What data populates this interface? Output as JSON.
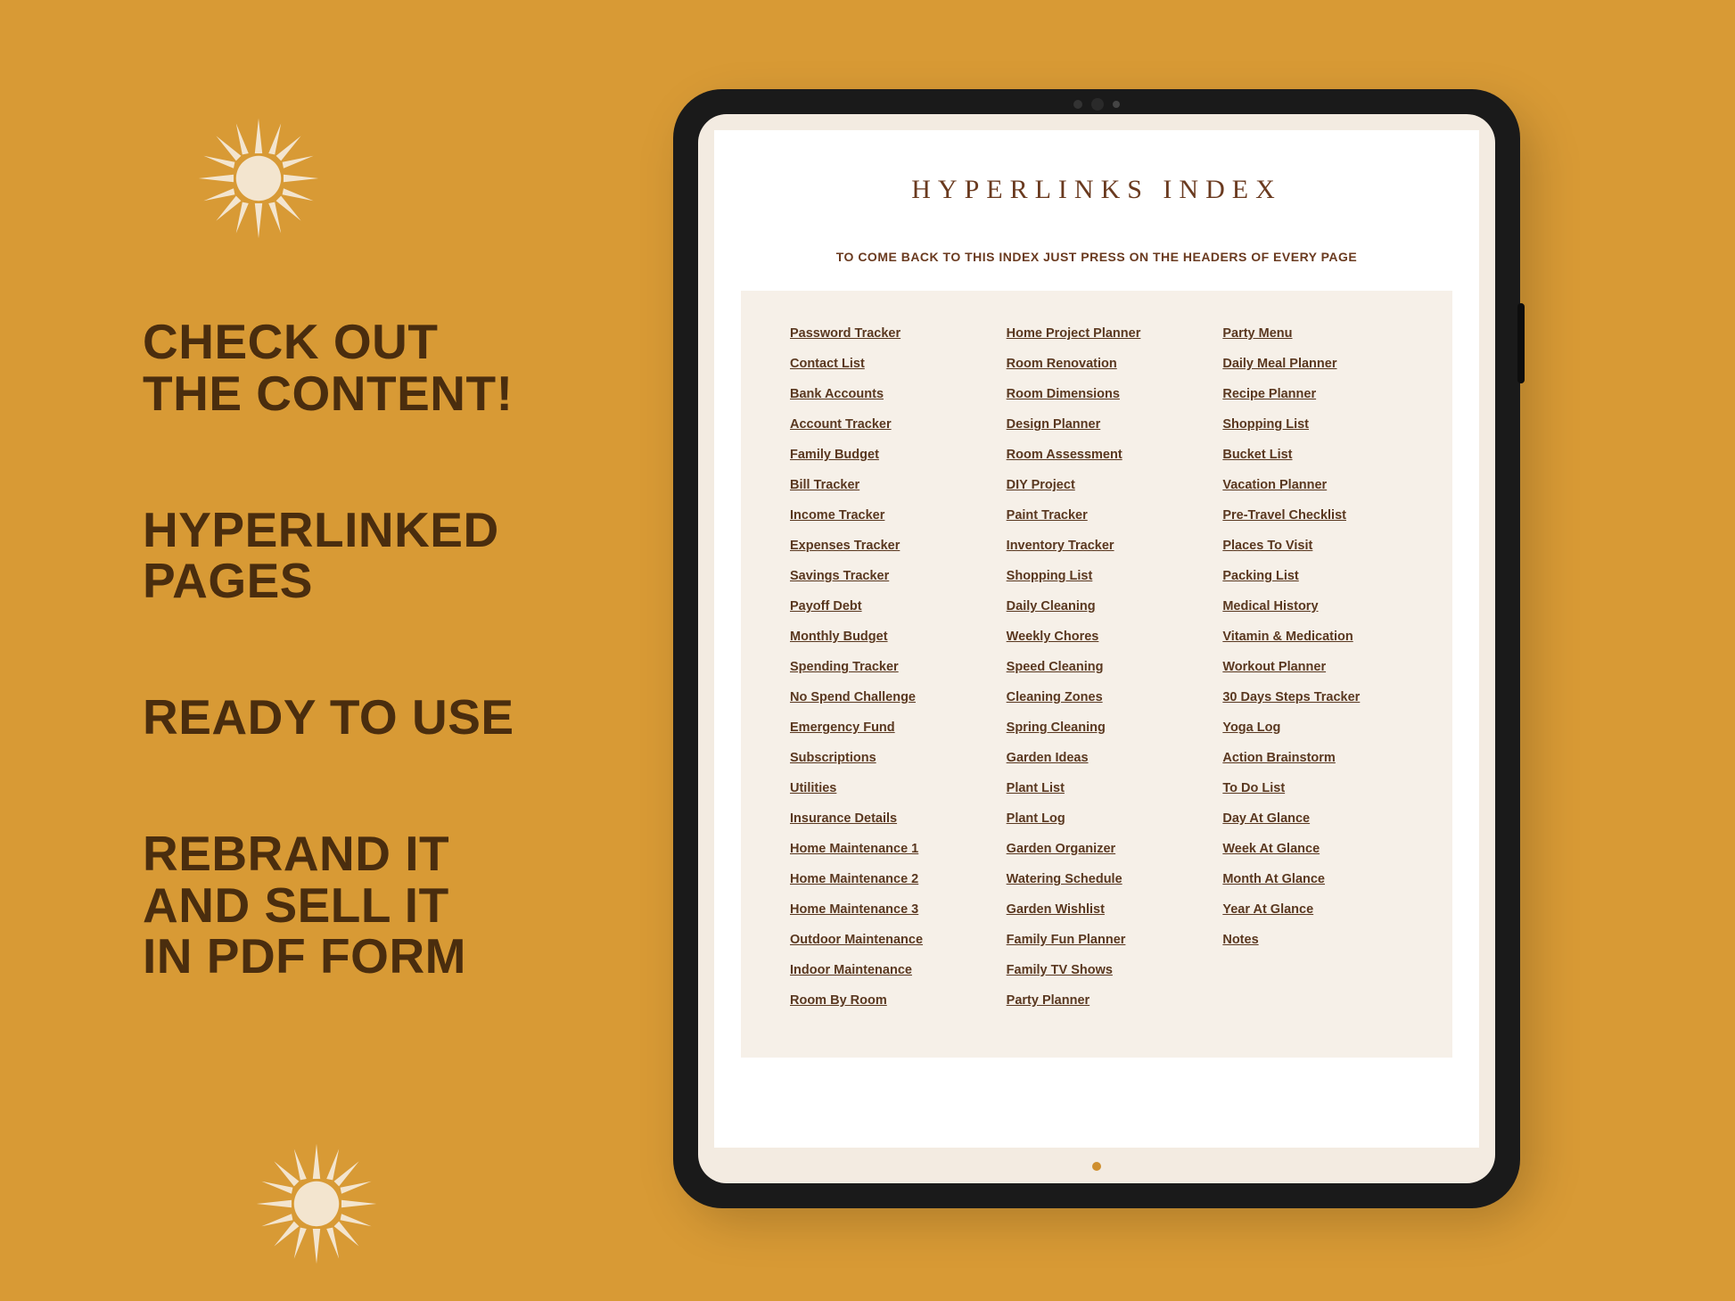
{
  "promo": {
    "line1a": "CHECK OUT",
    "line1b": "THE CONTENT!",
    "line2a": "HYPERLINKED",
    "line2b": "PAGES",
    "line3": "READY TO USE",
    "line4a": "REBRAND IT",
    "line4b": "AND SELL IT",
    "line4c": "IN PDF FORM"
  },
  "page": {
    "title": "HYPERLINKS INDEX",
    "subtitle": "TO COME BACK TO THIS INDEX JUST PRESS ON THE HEADERS OF EVERY PAGE"
  },
  "columns": [
    [
      "Password Tracker",
      "Contact List",
      "Bank Accounts",
      "Account Tracker",
      "Family Budget",
      "Bill Tracker",
      "Income Tracker",
      "Expenses Tracker",
      "Savings Tracker",
      "Payoff Debt",
      "Monthly Budget",
      "Spending Tracker",
      "No Spend Challenge",
      "Emergency Fund",
      "Subscriptions",
      "Utilities",
      "Insurance Details",
      "Home Maintenance 1",
      "Home Maintenance 2",
      "Home Maintenance 3",
      "Outdoor Maintenance",
      "Indoor Maintenance",
      "Room By Room"
    ],
    [
      "Home Project Planner",
      "Room Renovation",
      "Room Dimensions",
      "Design Planner",
      "Room Assessment",
      "DIY Project",
      "Paint Tracker",
      "Inventory Tracker",
      "Shopping List",
      "Daily Cleaning",
      "Weekly Chores",
      "Speed Cleaning",
      "Cleaning Zones",
      "Spring Cleaning",
      "Garden Ideas",
      "Plant List",
      "Plant Log",
      "Garden Organizer",
      "Watering Schedule",
      "Garden Wishlist",
      "Family Fun Planner",
      "Family TV Shows",
      "Party Planner"
    ],
    [
      "Party Menu",
      "Daily Meal Planner",
      "Recipe Planner",
      "Shopping List",
      "Bucket List",
      "Vacation Planner",
      "Pre-Travel Checklist",
      "Places To Visit",
      "Packing List",
      "Medical History",
      "Vitamin & Medication",
      "Workout Planner",
      "30 Days Steps Tracker",
      "Yoga Log",
      "Action Brainstorm",
      "To Do List",
      "Day At Glance",
      "Week At Glance",
      "Month At Glance",
      "Year At Glance",
      "Notes"
    ]
  ]
}
